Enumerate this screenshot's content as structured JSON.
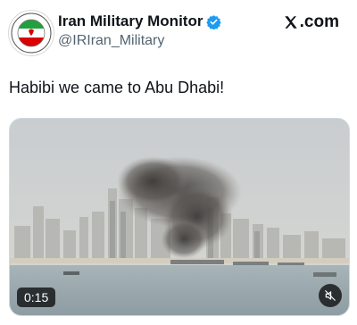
{
  "account": {
    "display_name": "Iran Military Monitor",
    "handle": "@IRIran_Military",
    "verified": true,
    "avatar_icon": "iran-flag-emblem-icon"
  },
  "brand": {
    "label": ".com",
    "icon": "x-logo-icon"
  },
  "tweet": {
    "text": "Habibi we came to Abu Dhabi!"
  },
  "video": {
    "timestamp": "0:15",
    "mute_icon": "muted-speaker-icon"
  },
  "colors": {
    "verified_blue": "#1d9bf0",
    "text_primary": "#0f1419",
    "text_secondary": "#536471"
  }
}
